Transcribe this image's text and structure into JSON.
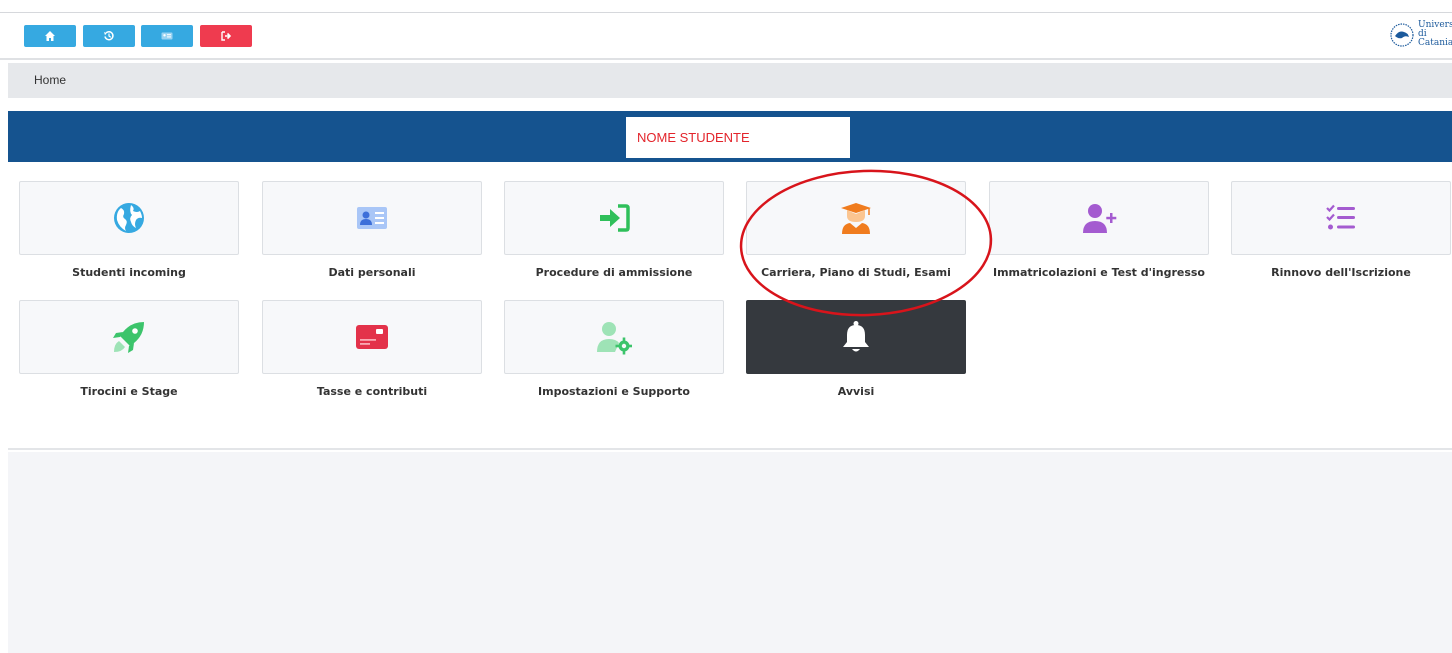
{
  "toolbar": {
    "buttons": [
      {
        "icon": "home-icon",
        "color": "#36a9e1"
      },
      {
        "icon": "history-icon",
        "color": "#36a9e1"
      },
      {
        "icon": "id-card-icon",
        "color": "#36a9e1"
      },
      {
        "icon": "logout-icon",
        "color": "#ef3b4f"
      }
    ]
  },
  "logo": {
    "line1": "Università",
    "line2": "di Catania"
  },
  "breadcrumb": {
    "home": "Home"
  },
  "student": {
    "name": "NOME STUDENTE",
    "name_color": "#e3242b",
    "band_color": "#15538f"
  },
  "tiles": [
    {
      "label": "Studenti incoming",
      "icon": "globe-icon",
      "color": "#36a9e1"
    },
    {
      "label": "Dati personali",
      "icon": "id-card-icon",
      "color": "#5b8def"
    },
    {
      "label": "Procedure di ammissione",
      "icon": "sign-in-icon",
      "color": "#2fbf5a"
    },
    {
      "label": "Carriera, Piano di Studi, Esami",
      "icon": "graduate-icon",
      "color": "#f07c1e"
    },
    {
      "label": "Immatricolazioni e Test d'ingresso",
      "icon": "user-plus-icon",
      "color": "#a45bd0"
    },
    {
      "label": "Rinnovo dell'Iscrizione",
      "icon": "checklist-icon",
      "color": "#a45bd0"
    },
    {
      "label": "Tirocini e Stage",
      "icon": "rocket-icon",
      "color": "#3cc46b"
    },
    {
      "label": "Tasse e contributi",
      "icon": "credit-card-icon",
      "color": "#e3324a"
    },
    {
      "label": "Impostazioni e Supporto",
      "icon": "user-cog-icon",
      "color": "#3cc46b"
    },
    {
      "label": "Avvisi",
      "icon": "bell-icon",
      "color": "#ffffff"
    }
  ],
  "annotation": {
    "shape": "ellipse",
    "color": "#d8141b",
    "target": "Carriera, Piano di Studi, Esami"
  }
}
